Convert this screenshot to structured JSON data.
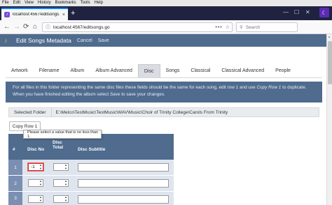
{
  "browser": {
    "menu": [
      "File",
      "Edit",
      "View",
      "History",
      "Bookmarks",
      "Tools",
      "Help"
    ],
    "tab_title": "localhost:4567/editsongs.go",
    "url": "localhost:4567/editsongs.go",
    "search_placeholder": "Search",
    "icons": {
      "back": "←",
      "forward": "→",
      "reload": "⟳",
      "home": "⌂",
      "tab_close": "×",
      "new_tab": "+",
      "url_info": "ⓘ",
      "url_more": "•••",
      "bookmark": "☆",
      "search": "⚲",
      "win_min": "—",
      "win_max": "☐",
      "win_close": "✕",
      "extension": "☾",
      "scroll_up": "▲"
    }
  },
  "app": {
    "title": "Edit Songs Metadata",
    "cancel_label": "Cancel",
    "save_label": "Save"
  },
  "tabs": [
    {
      "label": "Artwork"
    },
    {
      "label": "Filename"
    },
    {
      "label": "Album"
    },
    {
      "label": "Album Advanced"
    },
    {
      "label": "Disc"
    },
    {
      "label": "Songs"
    },
    {
      "label": "Classical"
    },
    {
      "label": "Classical Advanced"
    },
    {
      "label": "People"
    }
  ],
  "info": {
    "part1": "For all files in this folder representing the same disc files these fields should be the same for each song, edit row 1 and use ",
    "copy_row_ref": "Copy Row 1",
    "part2": " to duplicate.",
    "part3": "When you have finished editing the album select ",
    "save_ref": "Save",
    "part4": " to save your changes."
  },
  "folder": {
    "label": "Selected Folder",
    "value": "E:\\Melco\\TestMusic\\TestMusic\\WAV\\Music\\Choir of Trinity College\\Carols From Trinity"
  },
  "copy_row_label": "Copy Row 1",
  "table": {
    "headers": {
      "num": "#",
      "disc_no": "Disc No",
      "disc_total_1": "Disc",
      "disc_total_2": "Total",
      "subtitle": "Disc Subtitle"
    },
    "rows": [
      {
        "num": "1",
        "disc_no": "-1",
        "disc_total": "",
        "subtitle": ""
      },
      {
        "num": "2",
        "disc_no": "",
        "disc_total": "",
        "subtitle": ""
      },
      {
        "num": "3",
        "disc_no": "",
        "disc_total": "",
        "subtitle": ""
      }
    ]
  },
  "validation_tooltip": "Please select a value that is no less than 1."
}
